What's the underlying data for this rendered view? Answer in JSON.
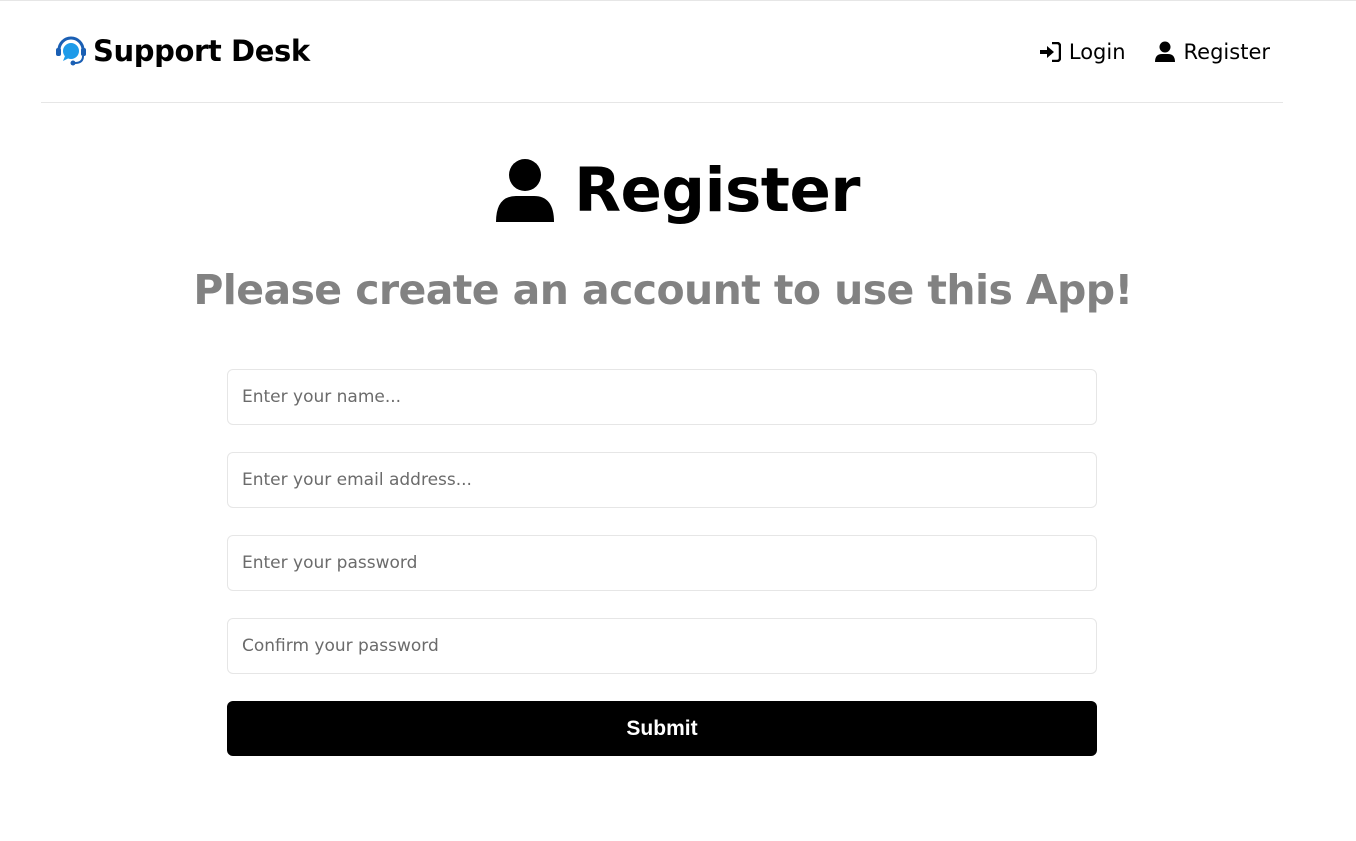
{
  "header": {
    "brand": "Support Desk",
    "brand_icon": "support-headset-icon",
    "nav": [
      {
        "label": "Login",
        "icon": "sign-in-icon"
      },
      {
        "label": "Register",
        "icon": "user-icon"
      }
    ]
  },
  "main": {
    "title": "Register",
    "title_icon": "user-icon",
    "subtitle": "Please create an account to use this App!"
  },
  "form": {
    "name": {
      "value": "",
      "placeholder": "Enter your name..."
    },
    "email": {
      "value": "",
      "placeholder": "Enter your email address..."
    },
    "password": {
      "value": "",
      "placeholder": "Enter your password"
    },
    "password2": {
      "value": "",
      "placeholder": "Confirm your password"
    },
    "submit_label": "Submit"
  },
  "colors": {
    "brand_icon_blue": "#1e9be9",
    "brand_icon_dark": "#1a5fb4",
    "subtitle": "#828282",
    "button_bg": "#000000",
    "border": "#e6e6e6"
  }
}
